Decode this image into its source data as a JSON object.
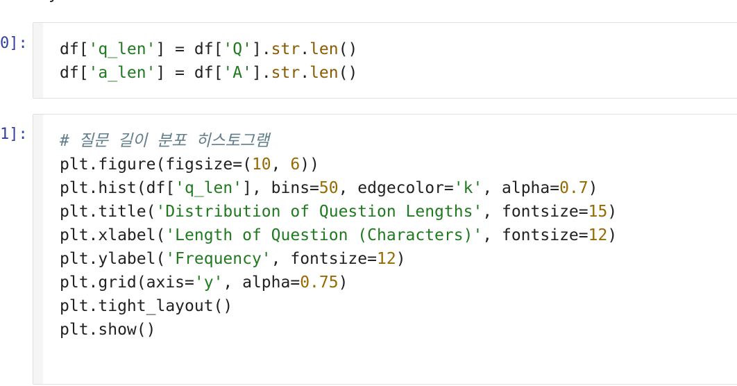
{
  "colors": {
    "prompt": "#303f9f",
    "name": "#212121",
    "string": "#1f7a1f",
    "number": "#986801",
    "builtin": "#8a5a00",
    "comment": "#607d8b",
    "cell_bg": "#f5f5f5",
    "cell_border": "#e0e0e0"
  },
  "top_fragment": "y",
  "cells": [
    {
      "prompt": "0]:",
      "lines": [
        [
          {
            "t": "df[",
            "k": "n"
          },
          {
            "t": "'q_len'",
            "k": "s"
          },
          {
            "t": "] = df[",
            "k": "n"
          },
          {
            "t": "'Q'",
            "k": "s"
          },
          {
            "t": "].",
            "k": "n"
          },
          {
            "t": "str",
            "k": "b"
          },
          {
            "t": ".",
            "k": "n"
          },
          {
            "t": "len",
            "k": "b"
          },
          {
            "t": "()",
            "k": "n"
          }
        ],
        [
          {
            "t": "df[",
            "k": "n"
          },
          {
            "t": "'a_len'",
            "k": "s"
          },
          {
            "t": "] = df[",
            "k": "n"
          },
          {
            "t": "'A'",
            "k": "s"
          },
          {
            "t": "].",
            "k": "n"
          },
          {
            "t": "str",
            "k": "b"
          },
          {
            "t": ".",
            "k": "n"
          },
          {
            "t": "len",
            "k": "b"
          },
          {
            "t": "()",
            "k": "n"
          }
        ]
      ]
    },
    {
      "prompt": "1]:",
      "lines": [
        [
          {
            "t": "# 질문 길이 분포 히스토그램",
            "k": "c"
          }
        ],
        [
          {
            "t": "plt.figure(figsize=(",
            "k": "n"
          },
          {
            "t": "10",
            "k": "num"
          },
          {
            "t": ", ",
            "k": "n"
          },
          {
            "t": "6",
            "k": "num"
          },
          {
            "t": "))",
            "k": "n"
          }
        ],
        [
          {
            "t": "plt.hist(df[",
            "k": "n"
          },
          {
            "t": "'q_len'",
            "k": "s"
          },
          {
            "t": "], bins=",
            "k": "n"
          },
          {
            "t": "50",
            "k": "num"
          },
          {
            "t": ", edgecolor=",
            "k": "n"
          },
          {
            "t": "'k'",
            "k": "s"
          },
          {
            "t": ", alpha=",
            "k": "n"
          },
          {
            "t": "0.7",
            "k": "num"
          },
          {
            "t": ")",
            "k": "n"
          }
        ],
        [
          {
            "t": "plt.title(",
            "k": "n"
          },
          {
            "t": "'Distribution of Question Lengths'",
            "k": "s"
          },
          {
            "t": ", fontsize=",
            "k": "n"
          },
          {
            "t": "15",
            "k": "num"
          },
          {
            "t": ")",
            "k": "n"
          }
        ],
        [
          {
            "t": "plt.xlabel(",
            "k": "n"
          },
          {
            "t": "'Length of Question (Characters)'",
            "k": "s"
          },
          {
            "t": ", fontsize=",
            "k": "n"
          },
          {
            "t": "12",
            "k": "num"
          },
          {
            "t": ")",
            "k": "n"
          }
        ],
        [
          {
            "t": "plt.ylabel(",
            "k": "n"
          },
          {
            "t": "'Frequency'",
            "k": "s"
          },
          {
            "t": ", fontsize=",
            "k": "n"
          },
          {
            "t": "12",
            "k": "num"
          },
          {
            "t": ")",
            "k": "n"
          }
        ],
        [
          {
            "t": "plt.grid(axis=",
            "k": "n"
          },
          {
            "t": "'y'",
            "k": "s"
          },
          {
            "t": ", alpha=",
            "k": "n"
          },
          {
            "t": "0.75",
            "k": "num"
          },
          {
            "t": ")",
            "k": "n"
          }
        ],
        [
          {
            "t": "plt.tight_layout()",
            "k": "n"
          }
        ],
        [
          {
            "t": "plt.show()",
            "k": "n"
          }
        ]
      ]
    }
  ]
}
